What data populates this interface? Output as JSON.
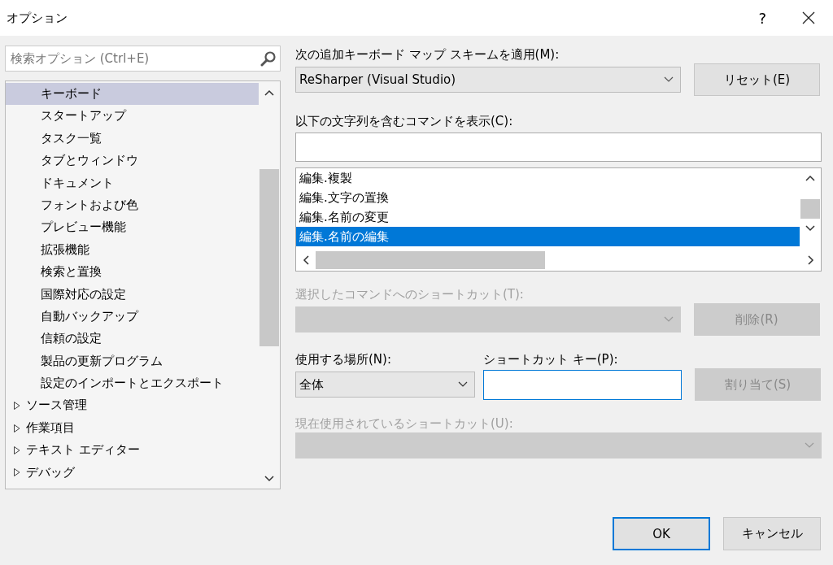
{
  "window": {
    "title": "オプション",
    "help": "?"
  },
  "search": {
    "placeholder": "検索オプション (Ctrl+E)"
  },
  "tree": {
    "items": [
      {
        "kind": "leaf",
        "label": "キーボード",
        "selected": true
      },
      {
        "kind": "leaf",
        "label": "スタートアップ",
        "selected": false
      },
      {
        "kind": "leaf",
        "label": "タスク一覧",
        "selected": false
      },
      {
        "kind": "leaf",
        "label": "タブとウィンドウ",
        "selected": false
      },
      {
        "kind": "leaf",
        "label": "ドキュメント",
        "selected": false
      },
      {
        "kind": "leaf",
        "label": "フォントおよび色",
        "selected": false
      },
      {
        "kind": "leaf",
        "label": "プレビュー機能",
        "selected": false
      },
      {
        "kind": "leaf",
        "label": "拡張機能",
        "selected": false
      },
      {
        "kind": "leaf",
        "label": "検索と置換",
        "selected": false
      },
      {
        "kind": "leaf",
        "label": "国際対応の設定",
        "selected": false
      },
      {
        "kind": "leaf",
        "label": "自動バックアップ",
        "selected": false
      },
      {
        "kind": "leaf",
        "label": "信頼の設定",
        "selected": false
      },
      {
        "kind": "leaf",
        "label": "製品の更新プログラム",
        "selected": false
      },
      {
        "kind": "leaf",
        "label": "設定のインポートとエクスポート",
        "selected": false
      },
      {
        "kind": "folder",
        "label": "ソース管理",
        "selected": false,
        "expanded": false
      },
      {
        "kind": "folder",
        "label": "作業項目",
        "selected": false,
        "expanded": false
      },
      {
        "kind": "folder",
        "label": "テキスト エディター",
        "selected": false,
        "expanded": false
      },
      {
        "kind": "folder",
        "label": "デバッグ",
        "selected": false,
        "expanded": false
      }
    ]
  },
  "scheme": {
    "label": "次の追加キーボード マップ スキームを適用(M):",
    "value": "ReSharper (Visual Studio)",
    "button": "リセット(E)"
  },
  "filter": {
    "label": "以下の文字列を含むコマンドを表示(C):"
  },
  "commands": [
    {
      "label": "編集.複製",
      "selected": false
    },
    {
      "label": "編集.文字の置換",
      "selected": false
    },
    {
      "label": "編集.名前の変更",
      "selected": false
    },
    {
      "label": "編集.名前の編集",
      "selected": true
    }
  ],
  "selected_shortcuts": {
    "label": "選択したコマンドへのショートカット(T):",
    "disabled": true,
    "button": "削除(R)"
  },
  "scope": {
    "label": "使用する場所(N):",
    "value": "全体"
  },
  "shortcut_key": {
    "label": "ショートカット キー(P):",
    "button": "割り当て(S)",
    "button_disabled": true
  },
  "current_shortcuts": {
    "label": "現在使用されているショートカット(U):",
    "disabled": true
  },
  "buttons": [
    {
      "label": "OK",
      "kind": "default"
    },
    {
      "label": "キャンセル",
      "kind": "normal"
    }
  ]
}
